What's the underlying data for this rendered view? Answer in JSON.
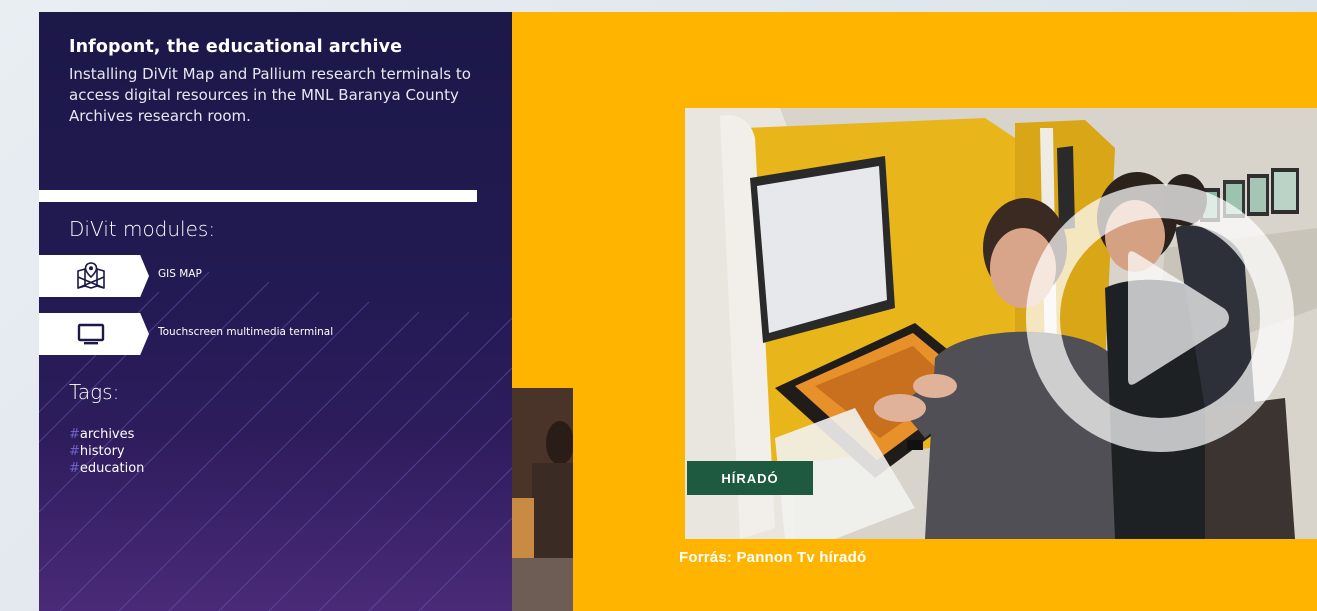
{
  "info": {
    "title": "Infopont, the educational archive",
    "description": "Installing DiVit Map and Pallium research terminals to access digital resources in the MNL Baranya County Archives research room."
  },
  "modules": {
    "heading": "DiVit modules:",
    "items": [
      {
        "icon": "map-icon",
        "label": "GIS MAP"
      },
      {
        "icon": "monitor-icon",
        "label": "Touchscreen multimedia terminal"
      }
    ]
  },
  "tags": {
    "heading": "Tags:",
    "items": [
      "archives",
      "history",
      "education"
    ]
  },
  "video": {
    "caption": "Forrás: Pannon Tv híradó",
    "badge": "HÍRADÓ",
    "play_icon": "play-icon"
  },
  "colors": {
    "panel_bg": "#1c1848",
    "video_bg": "#ffb400",
    "tag_hash": "#6f63c6",
    "badge_bg": "#1d5a3f"
  }
}
